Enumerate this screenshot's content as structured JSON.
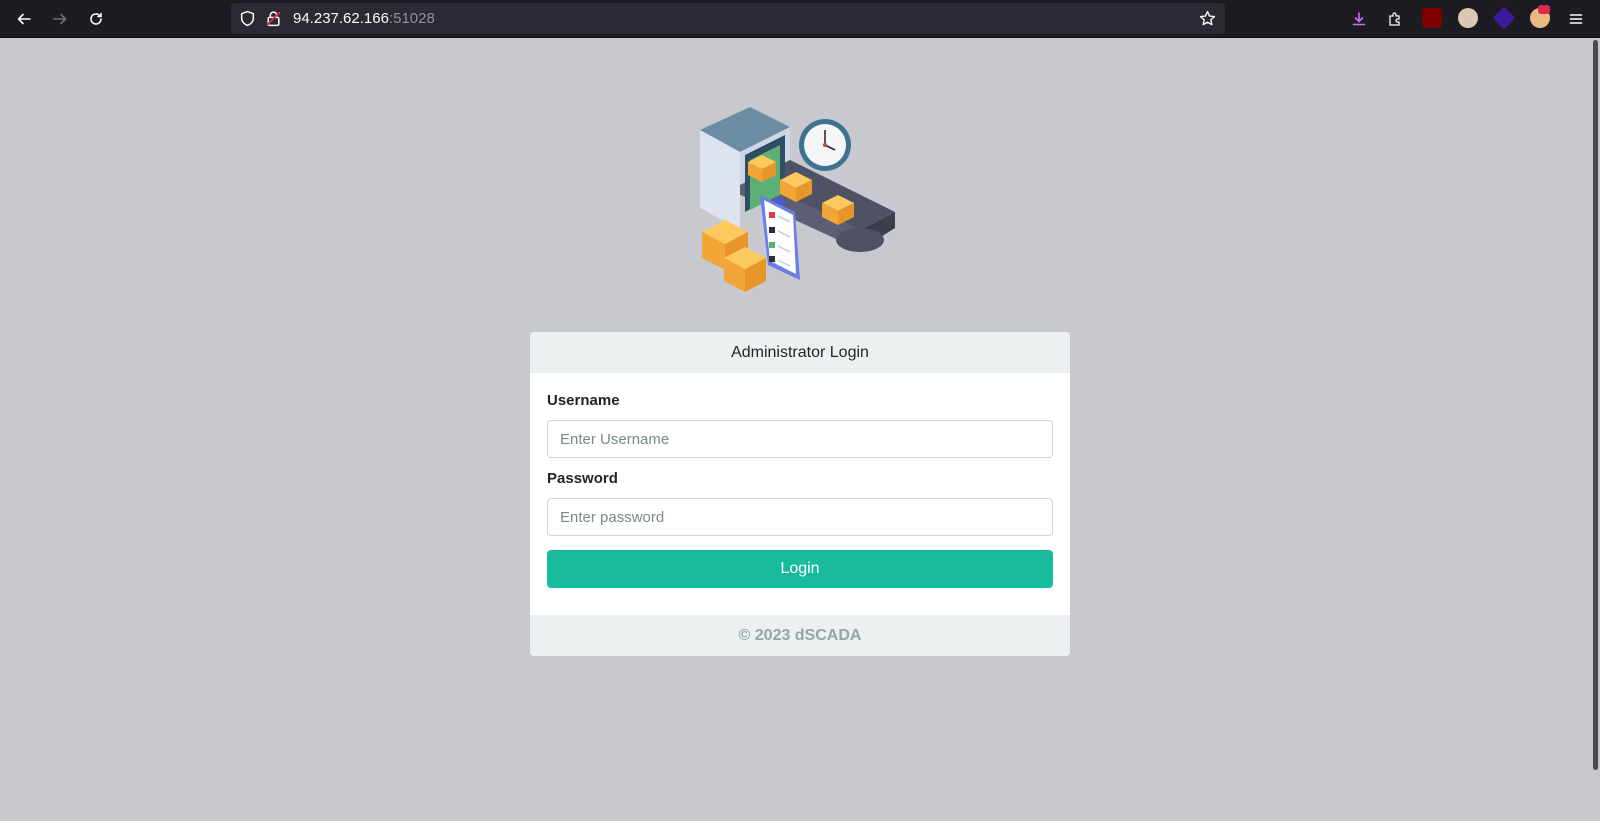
{
  "browser": {
    "url_host": "94.237.62.166",
    "url_port": ":51028",
    "icons": {
      "back": "back-arrow-icon",
      "forward": "forward-arrow-icon",
      "reload": "reload-icon",
      "shield": "tracking-protection-shield-icon",
      "lock": "insecure-lock-icon",
      "bookmark": "bookmark-star-icon",
      "downloads": "downloads-icon",
      "extensions": "extensions-puzzle-icon",
      "menu": "hamburger-menu-icon"
    }
  },
  "login": {
    "title": "Administrator Login",
    "username_label": "Username",
    "username_placeholder": "Enter Username",
    "username_value": "",
    "password_label": "Password",
    "password_placeholder": "Enter password",
    "password_value": "",
    "submit_label": "Login",
    "footer": "© 2023 dSCADA"
  },
  "colors": {
    "page_background": "#c8c9ce",
    "accent": "#18bc9c",
    "card_header": "#ecf0f1",
    "footer_text": "#95a5a6"
  }
}
